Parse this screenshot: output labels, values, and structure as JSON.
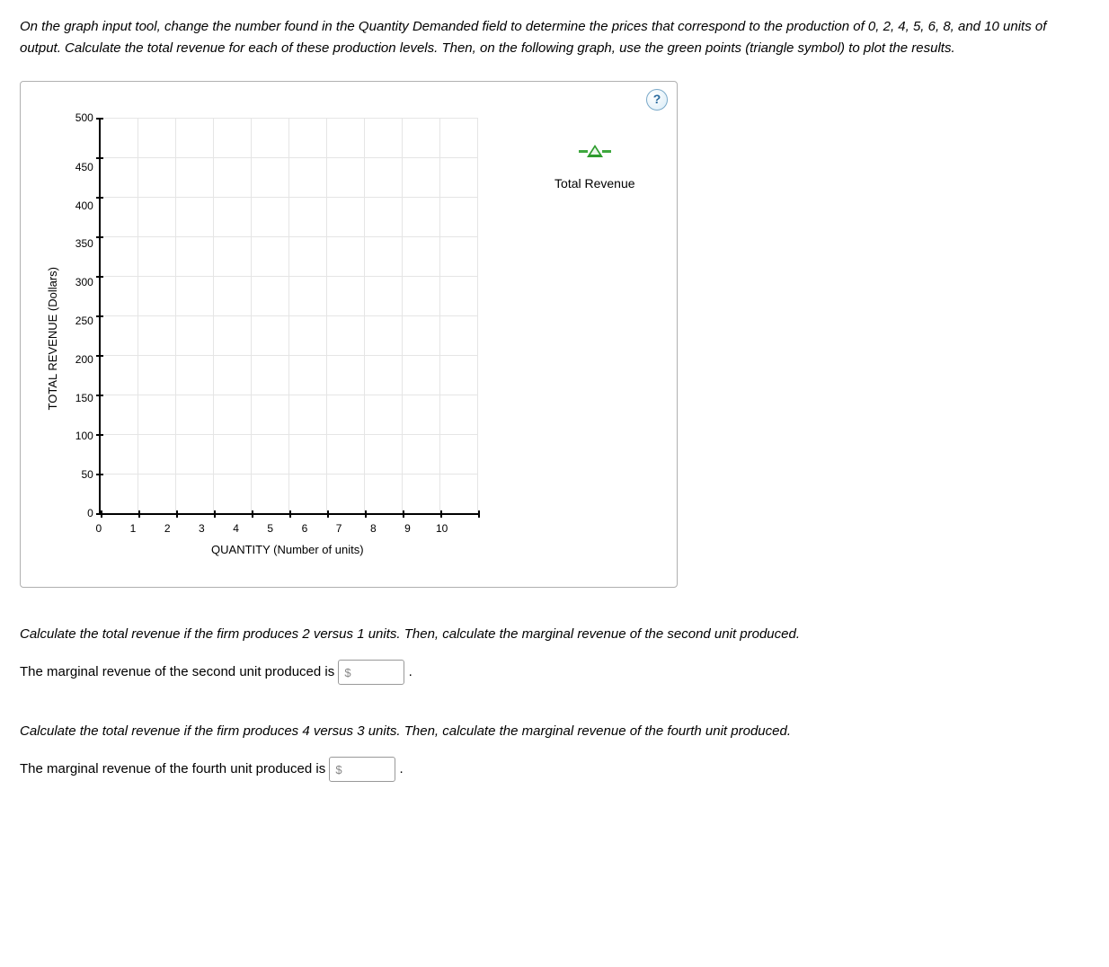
{
  "instructions": "On the graph input tool, change the number found in the Quantity Demanded field to determine the prices that correspond to the production of 0, 2, 4, 5, 6, 8, and 10 units of output. Calculate the total revenue for each of these production levels. Then, on the following graph, use the green points (triangle symbol) to plot the results.",
  "help": "?",
  "chart_data": {
    "type": "scatter",
    "title": "",
    "xlabel": "QUANTITY (Number of units)",
    "ylabel": "TOTAL REVENUE (Dollars)",
    "xlim": [
      0,
      10
    ],
    "ylim": [
      0,
      500
    ],
    "x_ticks": [
      "0",
      "1",
      "2",
      "3",
      "4",
      "5",
      "6",
      "7",
      "8",
      "9",
      "10"
    ],
    "y_ticks": [
      "500",
      "450",
      "400",
      "350",
      "300",
      "250",
      "200",
      "150",
      "100",
      "50",
      "0"
    ],
    "series": [
      {
        "name": "Total Revenue",
        "symbol": "triangle",
        "color": "#2c9b2c",
        "x": [],
        "y": []
      }
    ],
    "grid": true,
    "legend_position": "right"
  },
  "legend": {
    "total_revenue": "Total Revenue"
  },
  "q1": {
    "prompt": "Calculate the total revenue if the firm produces 2 versus 1 units. Then, calculate the marginal revenue of the second unit produced.",
    "answer_label_pre": "The marginal revenue of the second unit produced is ",
    "currency": "$",
    "value": "",
    "answer_label_post": " ."
  },
  "q2": {
    "prompt": "Calculate the total revenue if the firm produces 4 versus 3 units. Then, calculate the marginal revenue of the fourth unit produced.",
    "answer_label_pre": "The marginal revenue of the fourth unit produced is ",
    "currency": "$",
    "value": "",
    "answer_label_post": " ."
  }
}
